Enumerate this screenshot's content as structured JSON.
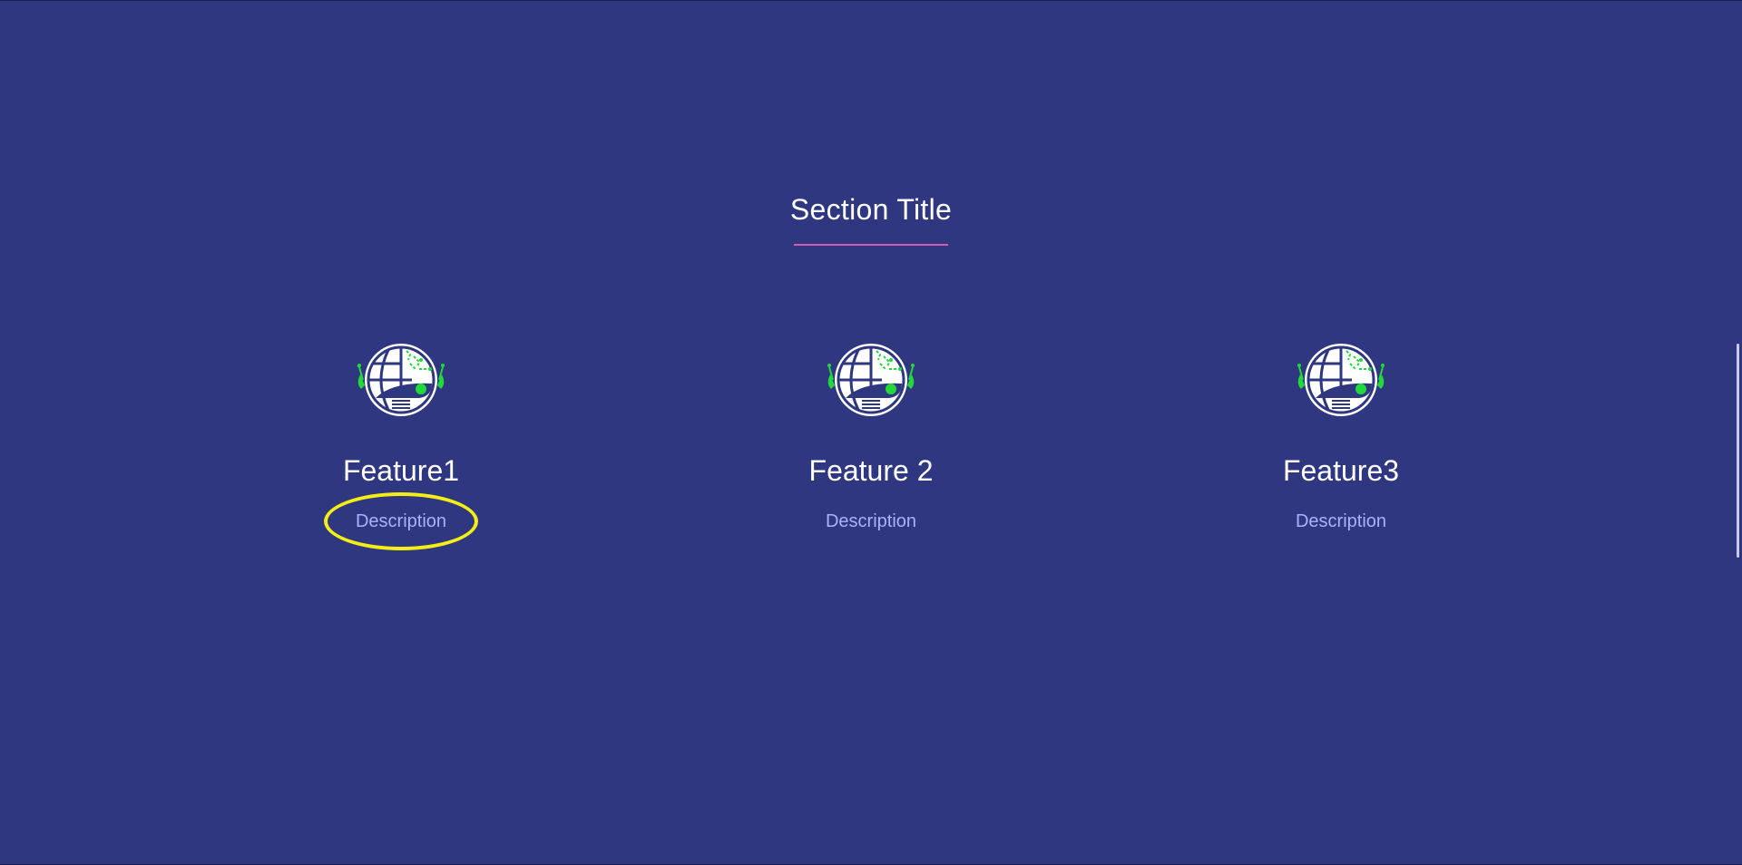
{
  "section": {
    "title": "Section Title"
  },
  "features": [
    {
      "title": "Feature1",
      "description": "Description",
      "icon": "globe-robot-icon"
    },
    {
      "title": "Feature 2",
      "description": "Description",
      "icon": "globe-robot-icon"
    },
    {
      "title": "Feature3",
      "description": "Description",
      "icon": "globe-robot-icon"
    }
  ],
  "colors": {
    "background": "#2e3780",
    "title": "#ffffff",
    "underline": "#d65ab0",
    "description": "#a9b2ff",
    "icon_accent": "#22d93a",
    "highlight": "#f4ee14"
  }
}
